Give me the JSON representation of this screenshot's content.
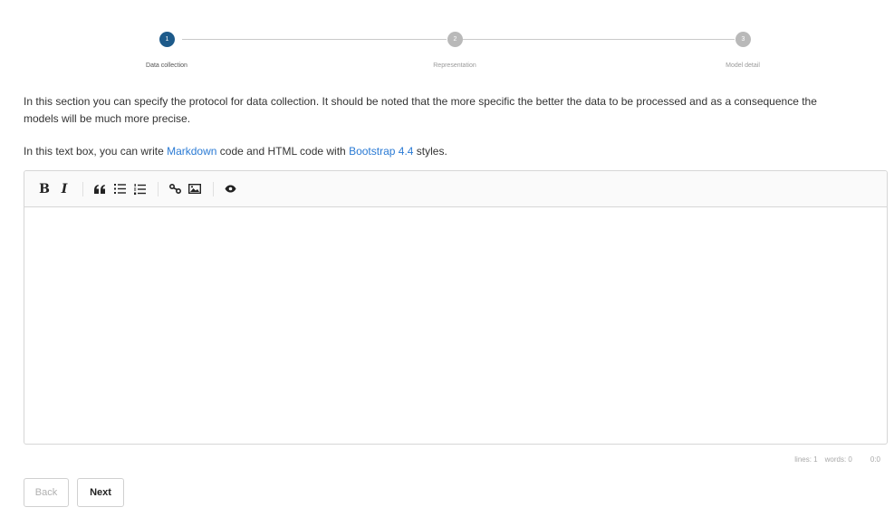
{
  "stepper": {
    "steps": [
      {
        "number": "1",
        "label": "Data collection",
        "state": "active"
      },
      {
        "number": "2",
        "label": "Representation",
        "state": "inactive"
      },
      {
        "number": "3",
        "label": "Model detail",
        "state": "inactive"
      }
    ]
  },
  "intro": {
    "line1": "In this section you can specify the protocol for data collection. It should be noted that the more specific the better the data to be processed and as a consequence the",
    "line2": "models will be much more precise."
  },
  "help": {
    "prefix": "In this text box, you can write ",
    "markdown_link": "Markdown",
    "middle": " code and HTML code with ",
    "bootstrap_link": "Bootstrap 4.4",
    "suffix": " styles."
  },
  "editor": {
    "toolbar": {
      "bold_label": "B",
      "italic_label": "I",
      "quote_icon": "quote-icon",
      "unordered_list_icon": "unordered-list-icon",
      "ordered_list_icon": "ordered-list-icon",
      "link_icon": "link-icon",
      "image_icon": "image-icon",
      "preview_icon": "eye-icon"
    },
    "content": "",
    "status": {
      "lines": "lines: 1",
      "words": "words: 0",
      "cursor": "0:0"
    }
  },
  "actions": {
    "back_label": "Back",
    "next_label": "Next"
  },
  "colors": {
    "active_step": "#1d5a8a",
    "inactive_step": "#b9b9b9",
    "link": "#2a7ad4"
  }
}
